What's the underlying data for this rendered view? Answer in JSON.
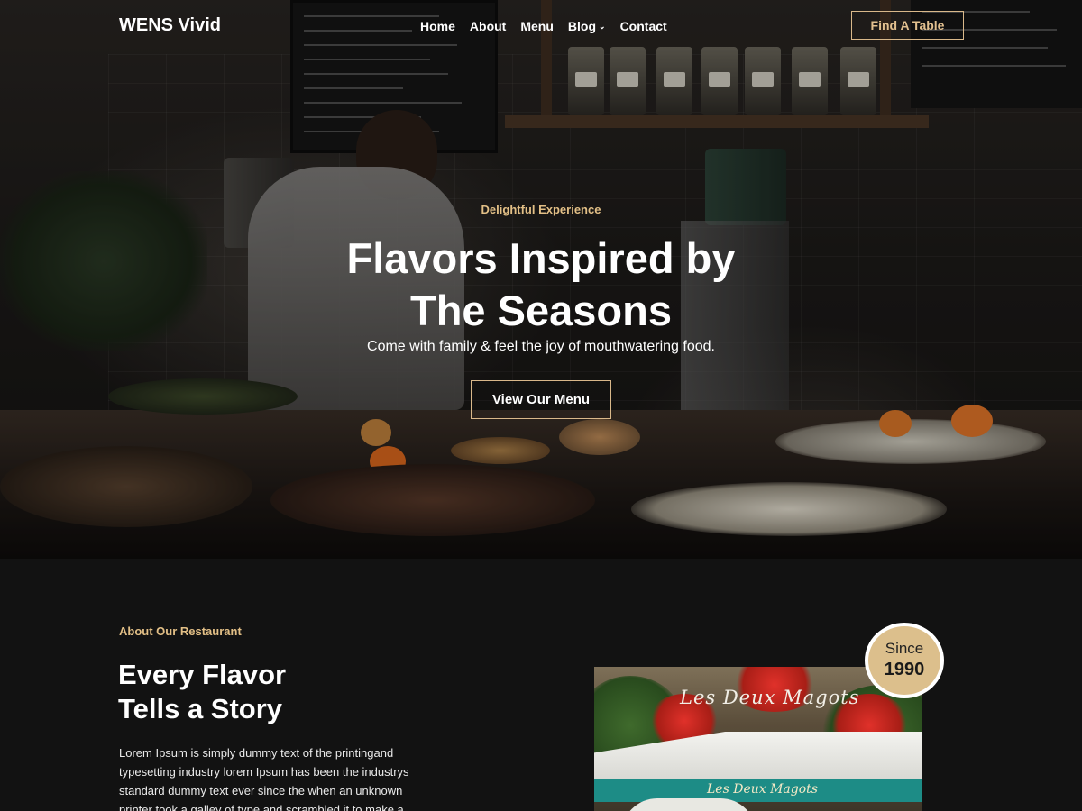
{
  "nav": {
    "brand": "WENS Vivid",
    "items": [
      {
        "label": "Home"
      },
      {
        "label": "About"
      },
      {
        "label": "Menu"
      },
      {
        "label": "Blog",
        "has_dropdown": true
      },
      {
        "label": "Contact"
      }
    ],
    "cta_label": "Find A Table"
  },
  "hero": {
    "eyebrow": "Delightful Experience",
    "title_line1": "Flavors Inspired by",
    "title_line2": "The Seasons",
    "subtitle": "Come with family & feel the joy of mouthwatering food.",
    "button_label": "View Our Menu"
  },
  "about": {
    "eyebrow": "About Our Restaurant",
    "title_line1": "Every Flavor",
    "title_line2": "Tells a Story",
    "body": "Lorem Ipsum is simply dummy text of the printingand typesetting industry lorem Ipsum has been the industrys standard dummy text ever since the when an unknown printer took a galley of type and scrambled it to make a",
    "photo_sign": "Les Deux Magots",
    "photo_awning": "Les Deux Magots",
    "badge_since": "Since",
    "badge_year": "1990"
  },
  "colors": {
    "accent": "#e2bf86",
    "background": "#121212",
    "badge": "#dcbf8c"
  },
  "icons": {
    "blog_dropdown": "chevron-down-icon"
  }
}
